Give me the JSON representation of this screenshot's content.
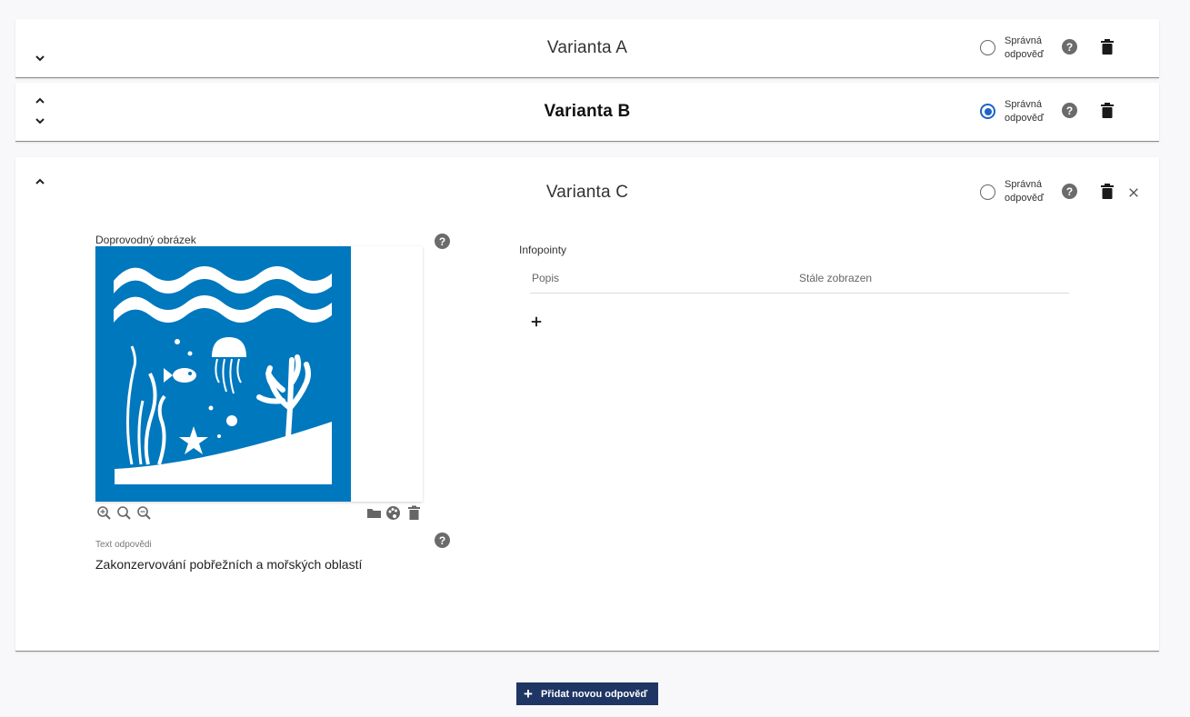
{
  "variants": [
    {
      "title": "Varianta A",
      "correct_label_line1": "Správná",
      "correct_label_line2": "odpověď",
      "selected": false
    },
    {
      "title": "Varianta B",
      "correct_label_line1": "Správná",
      "correct_label_line2": "odpověď",
      "selected": true
    },
    {
      "title": "Varianta C",
      "correct_label_line1": "Správná",
      "correct_label_line2": "odpověď",
      "selected": false
    }
  ],
  "expanded": {
    "image_label": "Doprovodný obrázek",
    "text_caption": "Text odpovědi",
    "text_value": "Zakonzervování pobřežních a mořských oblastí",
    "infopoints": {
      "title": "Infopointy",
      "columns": [
        "Popis",
        "Stále zobrazen"
      ]
    }
  },
  "add_button_label": "Přidat novou odpověď",
  "icons": {
    "chevron_down": "chevron-down-icon",
    "chevron_up": "chevron-up-icon",
    "help": "help-icon",
    "trash": "trash-icon",
    "close": "close-icon",
    "zoom_in": "zoom-in-icon",
    "zoom_reset": "zoom-reset-icon",
    "zoom_out": "zoom-out-icon",
    "folder": "folder-icon",
    "palette": "palette-icon",
    "plus": "plus-icon"
  },
  "colors": {
    "radio_selected": "#1e63c9",
    "image_background": "#0078be",
    "button_background": "#1f3564"
  }
}
